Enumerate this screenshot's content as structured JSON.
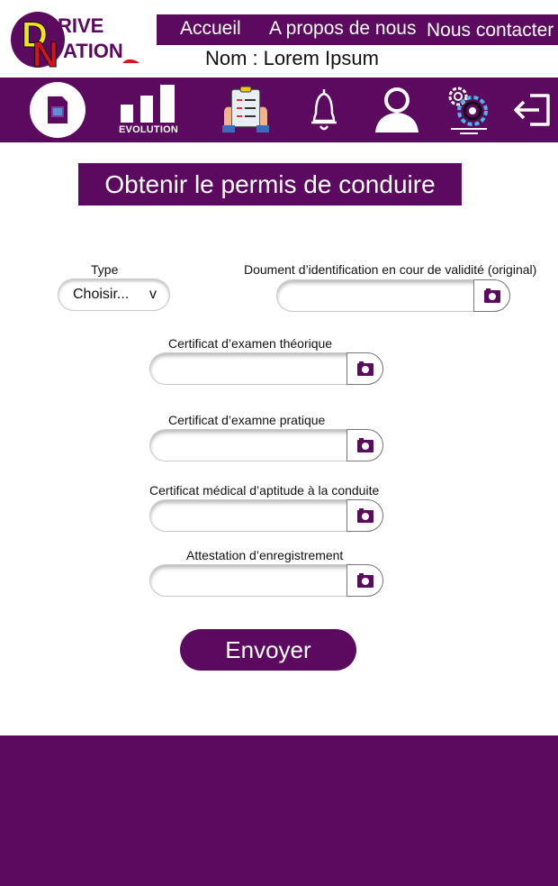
{
  "brand": {
    "logo_text_1": "RIVE",
    "logo_text_2": "ATION",
    "logo_letter_d": "D",
    "logo_letter_n": "N"
  },
  "topnav": {
    "home": "Accueil",
    "about": "A propos de nous",
    "contact": "Nous contacter"
  },
  "user": {
    "label": "Nom",
    "separator": ":",
    "name": "Lorem Ipsum"
  },
  "iconbar": {
    "items": [
      {
        "icon": "document-icon"
      },
      {
        "icon": "evolution-chart-icon",
        "label": "EVOLUTION"
      },
      {
        "icon": "checklist-icon"
      },
      {
        "icon": "bell-icon"
      },
      {
        "icon": "user-icon"
      },
      {
        "icon": "gears-icon"
      },
      {
        "icon": "logout-icon"
      }
    ]
  },
  "page": {
    "title": "Obtenir le permis de conduire"
  },
  "form": {
    "type": {
      "label": "Type",
      "value": "Choisir...",
      "chevron": "v"
    },
    "identity_doc": {
      "label": "Doument d’identification en cour de validité (original)",
      "value": ""
    },
    "theory_cert": {
      "label": "Certificat d’examen théorique",
      "value": ""
    },
    "practical_cert": {
      "label": "Certificat d’examne pratique",
      "value": ""
    },
    "medical_cert": {
      "label": "Certificat médical d’aptitude à la conduite",
      "value": ""
    },
    "registration": {
      "label": "Attestation d’enregistrement",
      "value": ""
    },
    "submit": "Envoyer"
  },
  "colors": {
    "primary": "#5c0a5f",
    "white": "#ffffff",
    "logo_yellow": "#f2e21a",
    "logo_red": "#d6141e"
  }
}
